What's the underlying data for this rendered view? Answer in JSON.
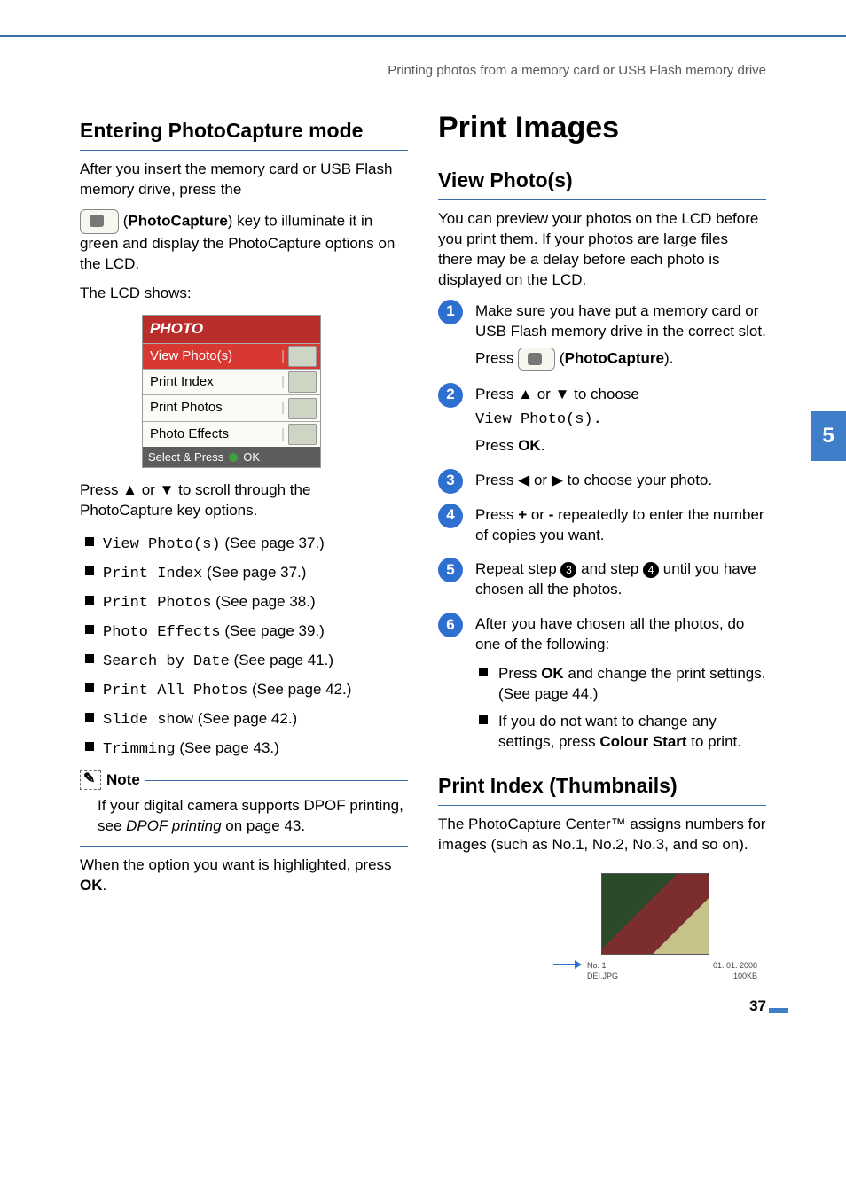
{
  "running_head": "Printing photos from a memory card or USB Flash memory drive",
  "side_tab": "5",
  "page_number": "37",
  "left": {
    "h1": "Entering PhotoCapture mode",
    "p1": "After you insert the memory card or USB Flash memory drive, press the",
    "pc_label": "PhotoCapture",
    "p2_tail": ") key to illuminate it in green and display the PhotoCapture options on the LCD.",
    "p3": "The LCD shows:",
    "lcd": {
      "title": "PHOTO",
      "rows": [
        "View Photo(s)",
        "Print Index",
        "Print Photos",
        "Photo Effects"
      ],
      "foot_label": "Select & Press",
      "foot_ok": "OK"
    },
    "p4": "Press ▲ or ▼ to scroll through the PhotoCapture key options.",
    "options": [
      {
        "code": "View Photo(s)",
        "tail": " (See page 37.)"
      },
      {
        "code": "Print Index",
        "tail": " (See page 37.)"
      },
      {
        "code": "Print Photos",
        "tail": " (See page 38.)"
      },
      {
        "code": "Photo Effects",
        "tail": " (See page 39.)"
      },
      {
        "code": "Search by Date",
        "tail": " (See page 41.)"
      },
      {
        "code": "Print All Photos",
        "tail": " (See page 42.)"
      },
      {
        "code": "Slide show",
        "tail": " (See page 42.)"
      },
      {
        "code": "Trimming",
        "tail": " (See page 43.)"
      }
    ],
    "note_head": "Note",
    "note_body_pre": "If your digital camera supports DPOF printing, see ",
    "note_body_em": "DPOF printing",
    "note_body_post": " on page 43.",
    "p5_pre": "When the option you want is highlighted, press ",
    "p5_ok": "OK",
    "p5_post": "."
  },
  "right": {
    "h_big": "Print Images",
    "h_view": "View Photo(s)",
    "p_view": "You can preview your photos on the LCD before you print them. If your photos are large files there may be a delay before each photo is displayed on the LCD.",
    "steps": [
      {
        "n": "1",
        "p1": "Make sure you have put a memory card or USB Flash memory drive in the correct slot.",
        "p2_pre": "Press ",
        "p2_pc": "PhotoCapture",
        "p2_post": ")."
      },
      {
        "n": "2",
        "p1": "Press ▲ or ▼ to choose",
        "code": "View Photo(s)",
        "p2_pre": "Press ",
        "p2_ok": "OK",
        "p2_post": "."
      },
      {
        "n": "3",
        "p1": "Press ◀ or ▶ to choose your photo."
      },
      {
        "n": "4",
        "p1_pre": "Press ",
        "plus": "+",
        "mid": " or ",
        "minus": "-",
        "p1_post": " repeatedly to enter the number of copies you want."
      },
      {
        "n": "5",
        "p1_pre": "Repeat step ",
        "ref1": "3",
        "mid": " and step ",
        "ref2": "4",
        "p1_post": " until you have chosen all the photos."
      },
      {
        "n": "6",
        "p1": "After you have chosen all the photos, do one of the following:",
        "sub": [
          {
            "pre": "Press ",
            "b": "OK",
            "post": " and change the print settings. (See page 44.)"
          },
          {
            "pre": "If you do not want to change any settings, press ",
            "b": "Colour Start",
            "post": " to print."
          }
        ]
      }
    ],
    "h_index": "Print Index (Thumbnails)",
    "p_index": "The PhotoCapture Center™ assigns numbers for images (such as No.1, No.2, No.3, and so on).",
    "thumb_meta_left1": "No. 1",
    "thumb_meta_left2": "DEI.JPG",
    "thumb_meta_right1": "01. 01. 2008",
    "thumb_meta_right2": "100KB"
  }
}
